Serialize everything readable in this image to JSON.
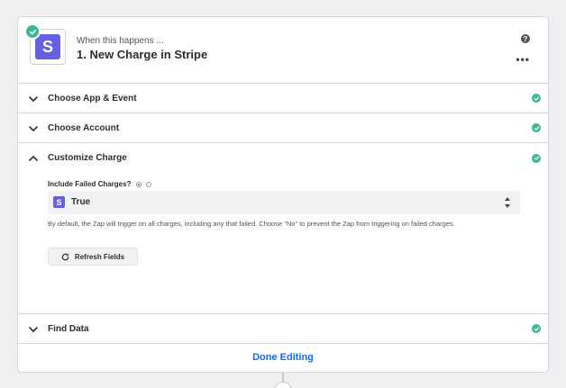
{
  "header": {
    "subtitle": "When this happens ...",
    "title": "1. New Charge in Stripe",
    "app_logo_letter": "S",
    "help_glyph": "?",
    "more_glyph": "•••",
    "help_icon": "question-circle-icon",
    "more_icon": "more-horizontal-icon"
  },
  "sections": {
    "choose_app": {
      "label": "Choose App & Event"
    },
    "choose_account": {
      "label": "Choose Account"
    },
    "customize": {
      "label": "Customize Charge",
      "field_label": "Include Failed Charges?",
      "select_value": "True",
      "select_logo_letter": "S",
      "helper_text": "By default, the Zap will trigger on all charges, including any that failed. Choose \"No\" to prevent the Zap from triggering on failed charges.",
      "refresh_label": "Refresh Fields"
    },
    "find_data": {
      "label": "Find Data"
    }
  },
  "footer": {
    "done_label": "Done Editing"
  },
  "colors": {
    "accent": "#136bf5",
    "success": "#3fb896",
    "stripe": "#6860e2"
  }
}
